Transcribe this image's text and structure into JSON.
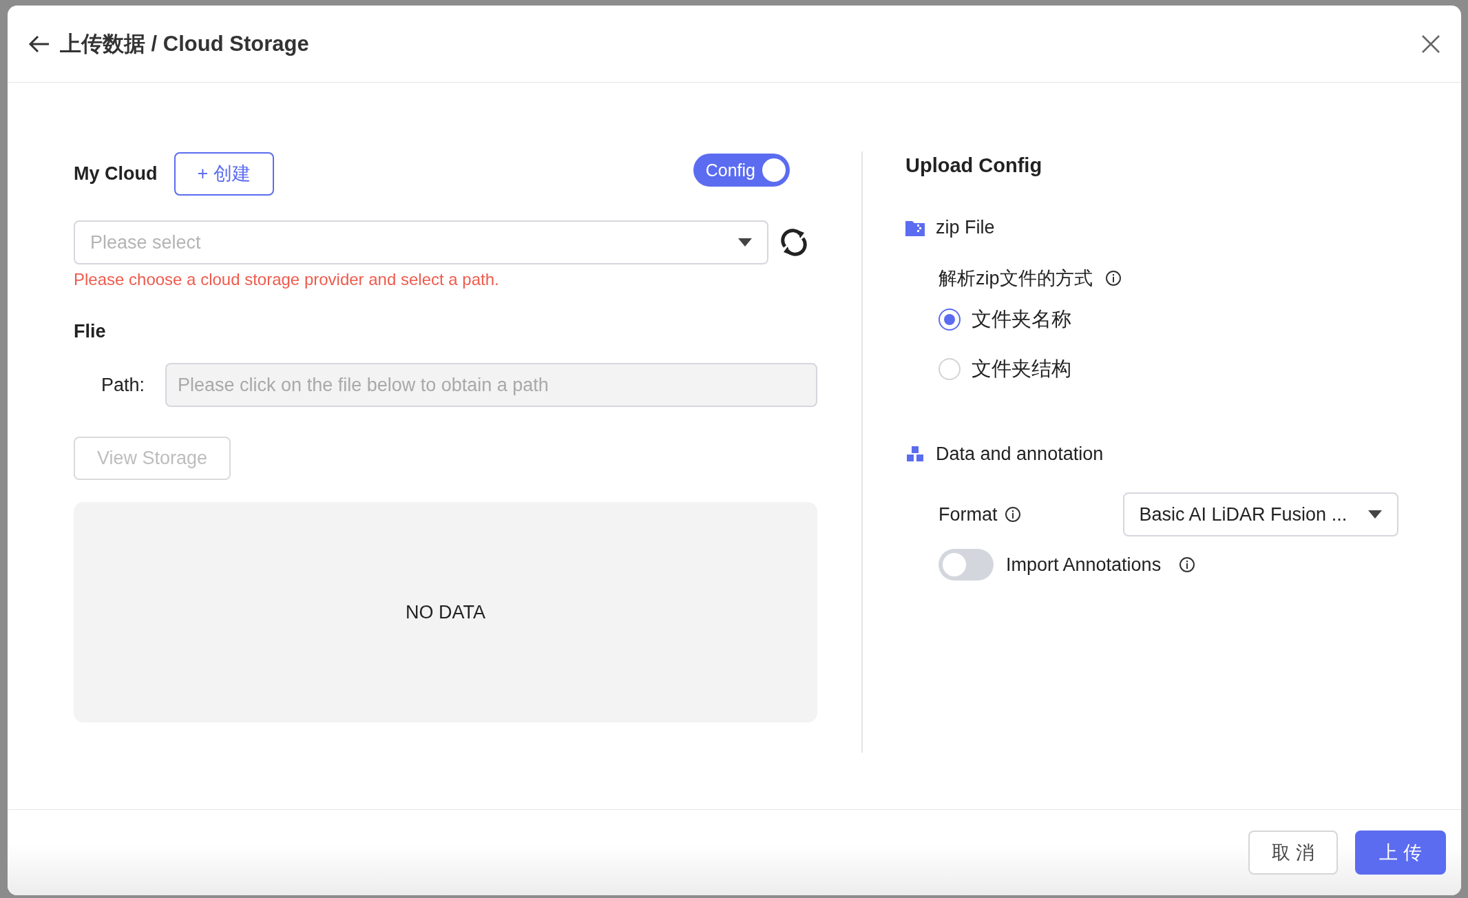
{
  "dialog": {
    "title": "上传数据 / Cloud Storage"
  },
  "my_cloud": {
    "label": "My Cloud",
    "create_button": "+ 创建",
    "config_toggle": {
      "label": "Config",
      "on": true
    },
    "select": {
      "placeholder": "Please select"
    },
    "error": "Please choose a cloud storage provider and select a path."
  },
  "file": {
    "heading": "Flie",
    "path_label": "Path:",
    "path_field": {
      "placeholder": "Please click on the file below to obtain a path"
    },
    "view_button": {
      "label": "View Storage",
      "disabled": true
    },
    "empty_text": "NO DATA"
  },
  "upload_config": {
    "heading": "Upload Config",
    "zip_section": {
      "title": "zip File",
      "question": "解析zip文件的方式",
      "options": [
        {
          "label": "文件夹名称",
          "selected": true
        },
        {
          "label": "文件夹结构",
          "selected": false
        }
      ]
    },
    "data_section": {
      "title": "Data and annotation",
      "format_label": "Format",
      "format_value": "Basic AI LiDAR Fusion ...",
      "import_toggle": {
        "label": "Import Annotations",
        "on": false
      }
    }
  },
  "footer": {
    "buttons": [
      {
        "label": "取 消",
        "kind": "secondary"
      },
      {
        "label": "上 传",
        "kind": "primary"
      }
    ]
  }
}
